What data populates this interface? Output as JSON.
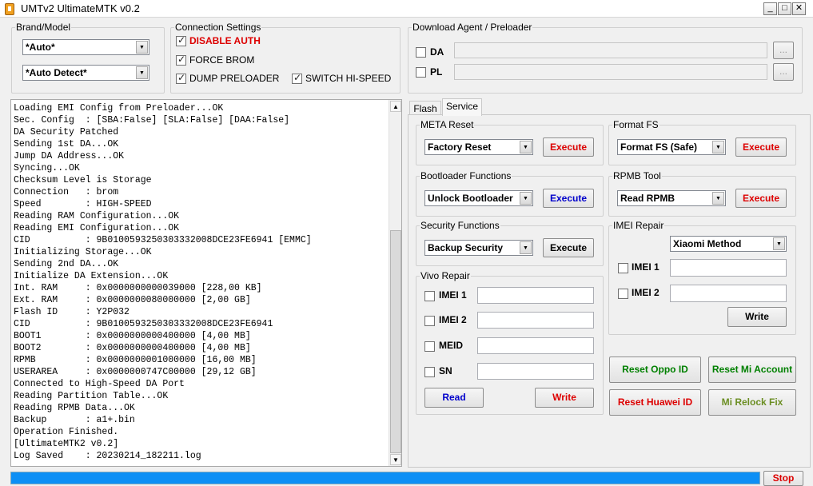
{
  "window": {
    "title": "UMTv2 UltimateMTK v0.2",
    "minimize": "_",
    "maximize": "□",
    "close": "✕"
  },
  "brand_model": {
    "legend": "Brand/Model",
    "brand": "*Auto*",
    "model": "*Auto Detect*"
  },
  "connection": {
    "legend": "Connection Settings",
    "disable_auth": "DISABLE AUTH",
    "force_brom": "FORCE BROM",
    "dump_preloader": "DUMP PRELOADER",
    "switch_hispeed": "SWITCH HI-SPEED"
  },
  "download_agent": {
    "legend": "Download Agent / Preloader",
    "da": "DA",
    "pl": "PL",
    "browse": "..."
  },
  "log": [
    "Loading EMI Config from Preloader...OK",
    "Sec. Config  : [SBA:False] [SLA:False] [DAA:False]",
    "DA Security Patched",
    "Sending 1st DA...OK",
    "Jump DA Address...OK",
    "Syncing...OK",
    "Checksum Level is Storage",
    "Connection   : brom",
    "Speed        : HIGH-SPEED",
    "Reading RAM Configuration...OK",
    "Reading EMI Configuration...OK",
    "CID          : 9B0100593250303332008DCE23FE6941 [EMMC]",
    "Initializing Storage...OK",
    "Sending 2nd DA...OK",
    "Initialize DA Extension...OK",
    "Int. RAM     : 0x0000000000039000 [228,00 KB]",
    "Ext. RAM     : 0x0000000080000000 [2,00 GB]",
    "Flash ID     : Y2P032",
    "CID          : 9B0100593250303332008DCE23FE6941",
    "BOOT1        : 0x0000000000400000 [4,00 MB]",
    "BOOT2        : 0x0000000000400000 [4,00 MB]",
    "RPMB         : 0x0000000001000000 [16,00 MB]",
    "USERAREA     : 0x0000000747C00000 [29,12 GB]",
    "Connected to High-Speed DA Port",
    "Reading Partition Table...OK",
    "Reading RPMB Data...OK",
    "Backup       : a1+.bin",
    "Operation Finished.",
    "[UltimateMTK2 v0.2]",
    "Log Saved    : 20230214_182211.log"
  ],
  "tabs": {
    "flash": "Flash",
    "service": "Service"
  },
  "meta_reset": {
    "legend": "META Reset",
    "option": "Factory Reset",
    "execute": "Execute"
  },
  "format_fs": {
    "legend": "Format FS",
    "option": "Format FS (Safe)",
    "execute": "Execute"
  },
  "bootloader": {
    "legend": "Bootloader Functions",
    "option": "Unlock Bootloader",
    "execute": "Execute"
  },
  "rpmb": {
    "legend": "RPMB Tool",
    "option": "Read RPMB",
    "execute": "Execute"
  },
  "security": {
    "legend": "Security Functions",
    "option": "Backup Security",
    "execute": "Execute"
  },
  "imei_repair": {
    "legend": "IMEI Repair",
    "method": "Xiaomi Method",
    "imei1": "IMEI 1",
    "imei2": "IMEI 2",
    "write": "Write"
  },
  "vivo": {
    "legend": "Vivo Repair",
    "imei1": "IMEI 1",
    "imei2": "IMEI 2",
    "meid": "MEID",
    "sn": "SN",
    "read": "Read",
    "write": "Write"
  },
  "actions": {
    "reset_oppo": "Reset Oppo ID",
    "reset_mi": "Reset Mi Account",
    "reset_huawei": "Reset Huawei ID",
    "mi_relock": "Mi Relock Fix"
  },
  "progress": {
    "value": 1.0
  },
  "stop": "Stop",
  "colors": {
    "red": "#dd0000",
    "blue": "#0000cc",
    "green": "#008000",
    "olive": "#6b8e23",
    "progress": "#0d8ff5"
  }
}
